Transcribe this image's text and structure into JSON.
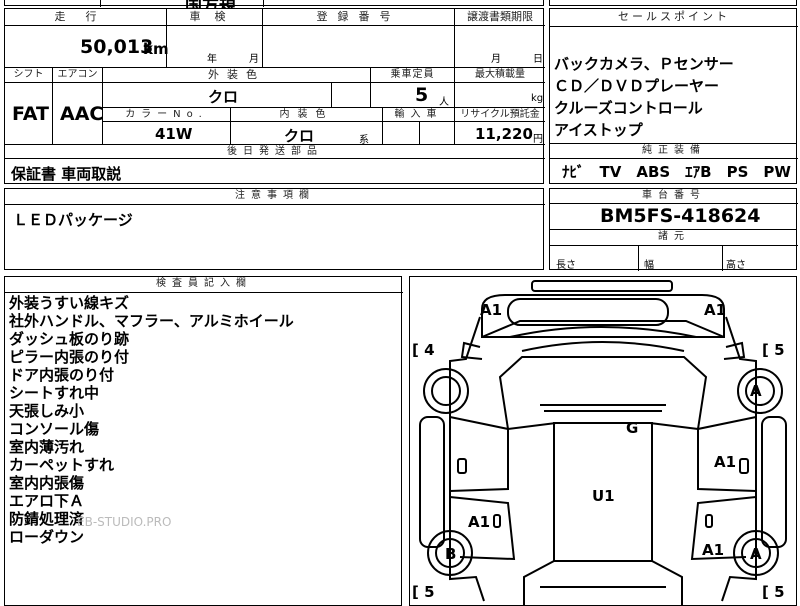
{
  "top_strip": {
    "cut_text": "国方規"
  },
  "vehicle_info": {
    "mileage_label": "走行",
    "mileage_value": "50,013",
    "mileage_unit": "km",
    "inspection_label": "車検",
    "inspection_year_unit": "年",
    "inspection_month_unit": "月",
    "registration_label": "登録番号",
    "transfer_deadline_label": "譲渡書類期限",
    "transfer_month_unit": "月",
    "transfer_day_unit": "日",
    "shift_label": "シフト",
    "shift_value": "FAT",
    "aircon_label": "エアコン",
    "aircon_value": "AAC",
    "exterior_color_label": "外装色",
    "exterior_color_value": "クロ",
    "capacity_label": "乗車定員",
    "capacity_value": "5",
    "capacity_unit": "人",
    "max_load_label": "最大積載量",
    "max_load_unit": "kg",
    "color_no_label": "カラーNo.",
    "color_no_value": "41W",
    "interior_color_label": "内装色",
    "interior_color_value": "クロ",
    "interior_color_suffix": "系",
    "import_label": "輸入車",
    "recycle_label": "リサイクル預託金",
    "recycle_value": "11,220",
    "recycle_unit": "円",
    "later_parts_label": "後日発送部品",
    "later_parts_value": "保証書 車両取説"
  },
  "sales_points": {
    "label": "セールスポイント",
    "items": [
      "バックカメラ、Ｐセンサー",
      "ＣＤ／ＤＶＤプレーヤー",
      "クルーズコントロール",
      "アイストップ"
    ]
  },
  "equipment": {
    "label": "純正装備",
    "value": "ﾅﾋﾞ　TV　ABS　ｴｱB　PS　PW"
  },
  "notes": {
    "label": "注意事項欄",
    "value": "ＬＥＤパッケージ"
  },
  "chassis": {
    "label": "車台番号",
    "value": "BM5FS-418624"
  },
  "dimensions": {
    "label": "諸元",
    "length_label": "長さ",
    "width_label": "幅",
    "height_label": "高さ"
  },
  "inspector": {
    "label": "検査員記入欄",
    "lines": [
      "外装うすい線キズ",
      "社外ハンドル、マフラー、アルミホイール",
      "ダッシュ板のり跡",
      "ピラー内張のり付",
      "ドア内張のり付",
      "シートすれ中",
      "天張しみ小",
      "コンソール傷",
      "室内薄汚れ",
      "カーペットすれ",
      "室内内張傷",
      "エアロ下Ａ",
      "防錆処理済",
      "ローダウン"
    ]
  },
  "diagram": {
    "marks": [
      "A1",
      "A1",
      "A",
      "G",
      "A1",
      "U1",
      "A1",
      "B",
      "A1",
      "A"
    ],
    "tires": [
      "[ 4",
      "[ 5",
      "[ 5",
      "[ 5"
    ]
  },
  "watermark": "EB-STUDIO.PRO"
}
